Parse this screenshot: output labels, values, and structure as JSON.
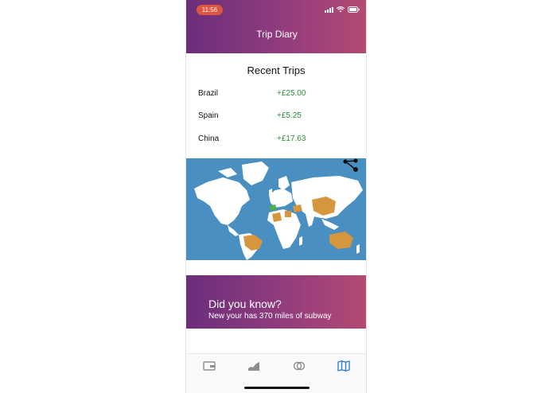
{
  "status": {
    "time": "11:56"
  },
  "header": {
    "title": "Trip Diary"
  },
  "recent": {
    "title": "Recent Trips",
    "trips": [
      {
        "country": "Brazil",
        "amount": "+£25.00"
      },
      {
        "country": "Spain",
        "amount": "+£5.25"
      },
      {
        "country": "China",
        "amount": "+£17.63"
      }
    ]
  },
  "fact": {
    "title": "Did you know?",
    "body": "New your has 370 miles of subway"
  },
  "colors": {
    "gradient_start": "#6b2e7a",
    "gradient_end": "#b44a72",
    "positive_amount": "#2e8b3e",
    "ocean": "#4a8fc2",
    "visited": "#d6963e",
    "active_tab": "#2f7fd8",
    "inactive_tab": "#8e8e8e"
  },
  "tabs": [
    {
      "icon": "wallet-icon",
      "active": false
    },
    {
      "icon": "chart-icon",
      "active": false
    },
    {
      "icon": "rings-icon",
      "active": false
    },
    {
      "icon": "map-icon",
      "active": true
    }
  ]
}
